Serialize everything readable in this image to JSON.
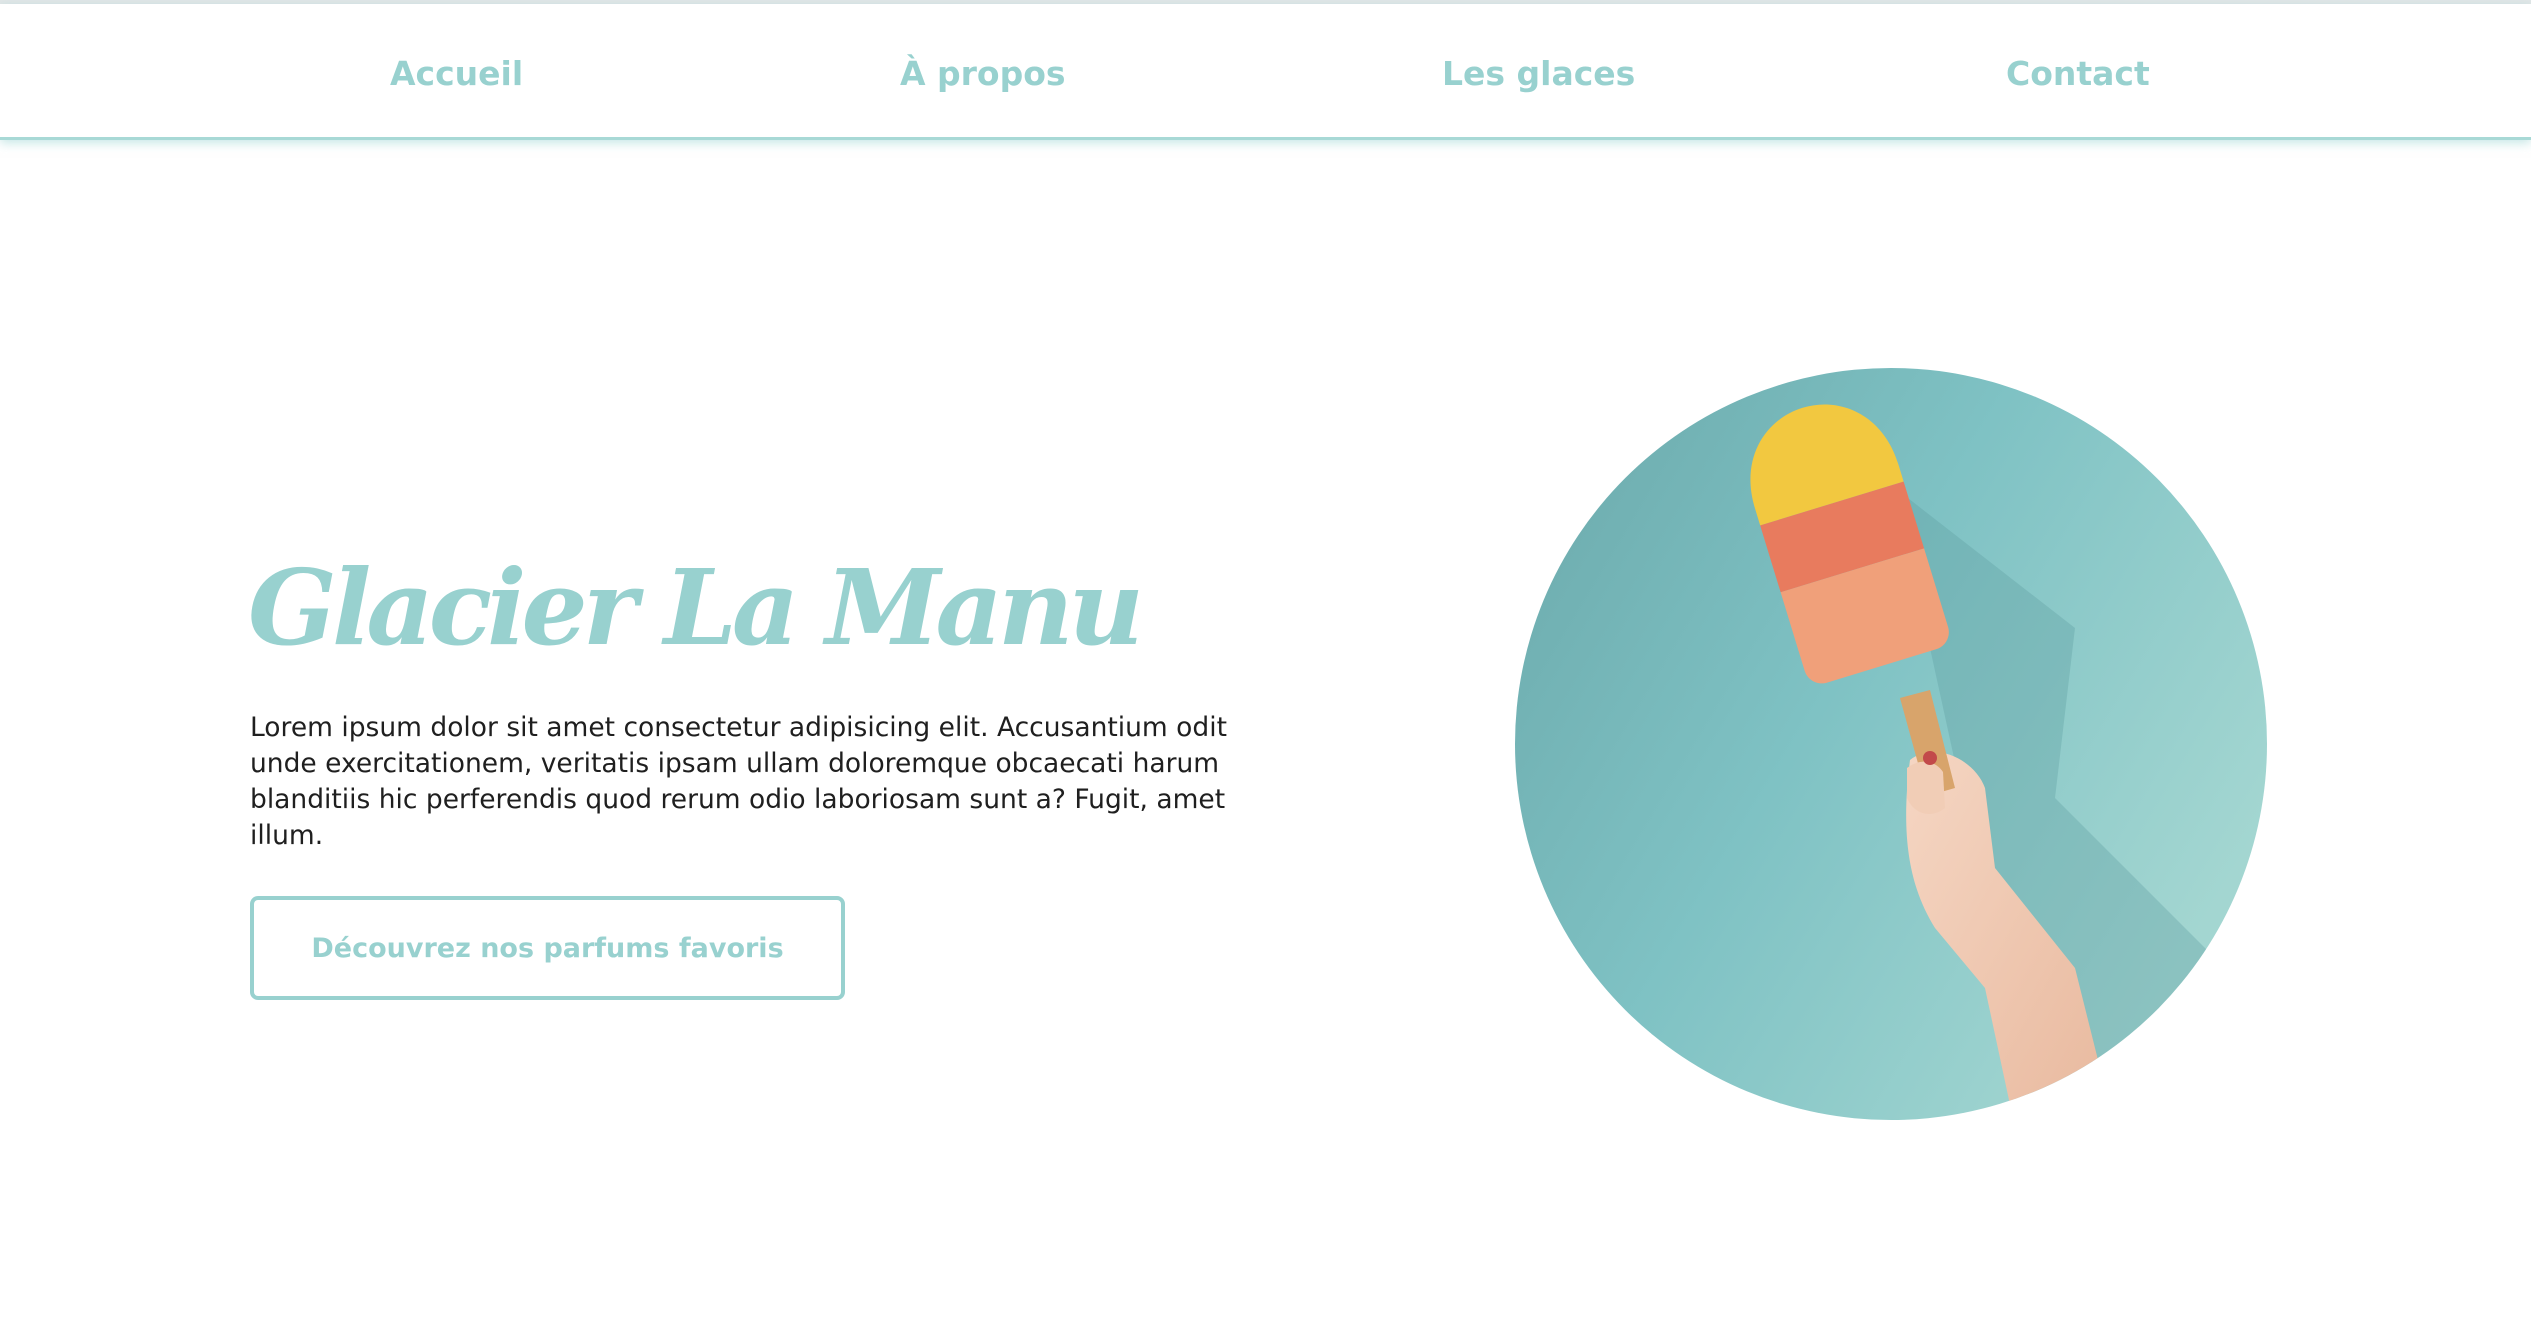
{
  "nav": {
    "items": [
      {
        "label": "Accueil"
      },
      {
        "label": "À propos"
      },
      {
        "label": "Les glaces"
      },
      {
        "label": "Contact"
      }
    ]
  },
  "hero": {
    "title": "Glacier La Manu",
    "text": "Lorem ipsum dolor sit amet consectetur adipisicing elit. Accusantium odit unde exercitationem, veritatis ipsam ullam doloremque obcaecati harum blanditiis hic perferendis quod rerum odio laboriosam sunt a? Fugit, amet illum.",
    "button_label": "Découvrez nos parfums favoris",
    "image_icon": "popsicle-photo"
  },
  "colors": {
    "accent": "#98d1cf",
    "text": "#1f1f1f",
    "background": "#ffffff",
    "photo_background": "#7cc2c4"
  }
}
